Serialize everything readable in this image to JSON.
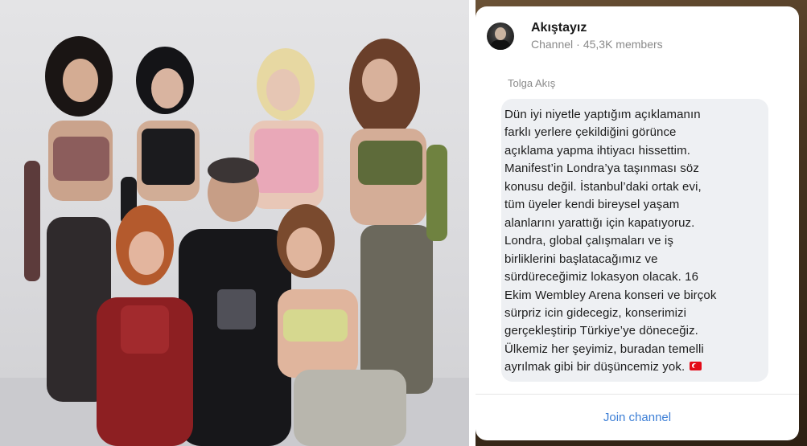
{
  "channel": {
    "name": "Akıştayız",
    "type": "Channel",
    "members": "45,3K members"
  },
  "message": {
    "sender": "Tolga Akış",
    "lines": [
      "Dün iyi niyetle yaptığım açıklamanın",
      "farklı yerlere çekildiğini görünce",
      "açıklama yapma ihtiyacı hissettim.",
      "Manifest’in Londra’ya taşınması söz",
      "konusu değil. İstanbul’daki ortak evi,",
      "tüm üyeler kendi bireysel yaşam",
      "alanlarını yarattığı için kapatıyoruz.",
      "Londra, global çalışmaları ve iş",
      "birliklerini başlatacağımız ve",
      "sürdüreceğimiz lokasyon olacak. 16",
      "Ekim Wembley Arena konseri ve birçok",
      "sürpriz icin gidecegiz, konserimizi",
      "gerçekleştirip Türkiye’ye döneceğiz.",
      "Ülkemiz her şeyimiz, buradan temelli",
      "ayrılmak gibi bir düşüncemiz yok."
    ],
    "flag_icon": "turkey-flag-icon"
  },
  "actions": {
    "join_label": "Join channel"
  },
  "colors": {
    "accent": "#3d7fd6",
    "bubble": "#eef0f3"
  }
}
